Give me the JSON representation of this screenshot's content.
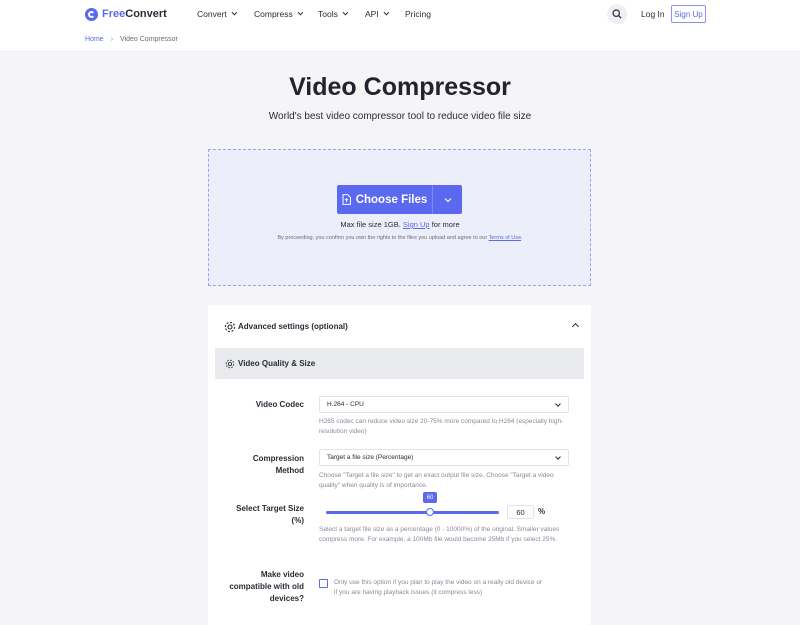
{
  "brand": {
    "name_prefix": "Free",
    "name_suffix": "Convert",
    "accent": "#5b68f0"
  },
  "nav": {
    "items": [
      {
        "label": "Convert",
        "has_dropdown": true
      },
      {
        "label": "Compress",
        "has_dropdown": true
      },
      {
        "label": "Tools",
        "has_dropdown": true
      },
      {
        "label": "API",
        "has_dropdown": true
      },
      {
        "label": "Pricing",
        "has_dropdown": false
      }
    ],
    "login": "Log In",
    "signup": "Sign Up"
  },
  "breadcrumb": {
    "home": "Home",
    "current": "Video Compressor"
  },
  "hero": {
    "title": "Video Compressor",
    "subtitle": "World's best video compressor tool to reduce video file size"
  },
  "upload": {
    "choose_label": "Choose Files",
    "max_prefix": "Max file size 1GB.",
    "max_link": "Sign Up",
    "max_suffix": "for more",
    "terms_prefix": "By proceeding, you confirm you own the rights to the files you upload and agree to our",
    "terms_link": "Terms of Use",
    "terms_suffix": "."
  },
  "settings": {
    "advanced_title": "Advanced settings (optional)",
    "section_title": "Video Quality & Size",
    "codec": {
      "label": "Video Codec",
      "value": "H.264 - CPU",
      "help": "H265 codec can reduce video size 20-75% more compared to H264 (especially high-resolution video)"
    },
    "method": {
      "label_line1": "Compression",
      "label_line2": "Method",
      "value": "Target a file size (Percentage)",
      "help": "Choose \"Target a file size\" to get an exact output file size. Choose \"Target a video quality\" when quality is of importance."
    },
    "target": {
      "label_line1": "Select Target Size",
      "label_line2": "(%)",
      "value": 60,
      "value_text": "60",
      "unit": "%",
      "help": "Select a target file size as a percentage (0 - 10000%) of the original. Smaller values compress more. For example, a 100Mb file would become 25Mb if you select 25%."
    },
    "compat": {
      "label_line1": "Make video",
      "label_line2": "compatible with old",
      "label_line3": "devices?",
      "checked": false,
      "help": "Only use this option if you plan to play the video on a really old device or if you are having playback issues (it compress less)"
    }
  }
}
